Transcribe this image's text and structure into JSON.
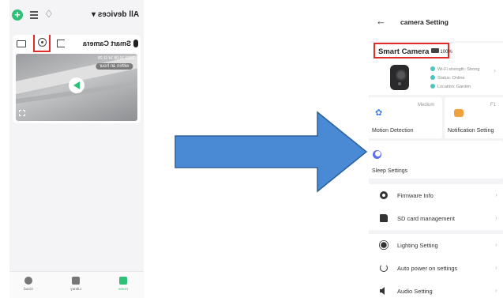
{
  "left_screen": {
    "header": {
      "all_devices_label": "All devices ▾",
      "add_icon": "plus-circle-icon",
      "list_icon": "list-icon",
      "bell_icon": "bell-icon"
    },
    "camera_card": {
      "name": "Smart Camera",
      "timestamp": "2023-10-08  14:11:28",
      "notice": "within an hour",
      "icons": [
        "mail-icon",
        "gear-icon",
        "share-icon",
        "play-icon",
        "fullscreen-icon"
      ]
    },
    "bottom_nav": {
      "items": [
        {
          "label": "Cloud",
          "icon": "cloud-icon"
        },
        {
          "label": "Library",
          "icon": "library-icon"
        },
        {
          "label": "Home",
          "icon": "home-icon"
        }
      ],
      "active_index": 2
    },
    "highlight_color": "#e02b2b",
    "accent_color": "#2fc077"
  },
  "arrow": {
    "fill_color": "#4a8ad4",
    "stroke_color": "#2b5f9e"
  },
  "right_screen": {
    "header": {
      "back_icon": "back-arrow-icon",
      "title": "camera Setting"
    },
    "device_summary": {
      "name": "Smart Camera",
      "battery": "100%",
      "wifi_strength": "Wi-Fi strength: Strong",
      "status": "Status: Online",
      "location": "Location: Garden"
    },
    "tiles": [
      {
        "label": "Motion Detection",
        "value": "Medium",
        "icon": "motion-run-icon"
      },
      {
        "label": "Notification Setting",
        "value": "F1",
        "icon": "notification-icon"
      },
      {
        "label": "Sleep Settings",
        "value": "",
        "icon": "sleep-icon"
      }
    ],
    "rows": [
      {
        "label": "Firmware Info",
        "icon": "firmware-icon"
      },
      {
        "label": "SD card management",
        "icon": "sd-card-icon"
      },
      {
        "label": "Lighting Setting",
        "icon": "light-icon"
      },
      {
        "label": "Auto power on settings",
        "icon": "power-icon"
      },
      {
        "label": "Audio Setting",
        "icon": "speaker-icon"
      }
    ],
    "highlight_color": "#e02b2b"
  }
}
